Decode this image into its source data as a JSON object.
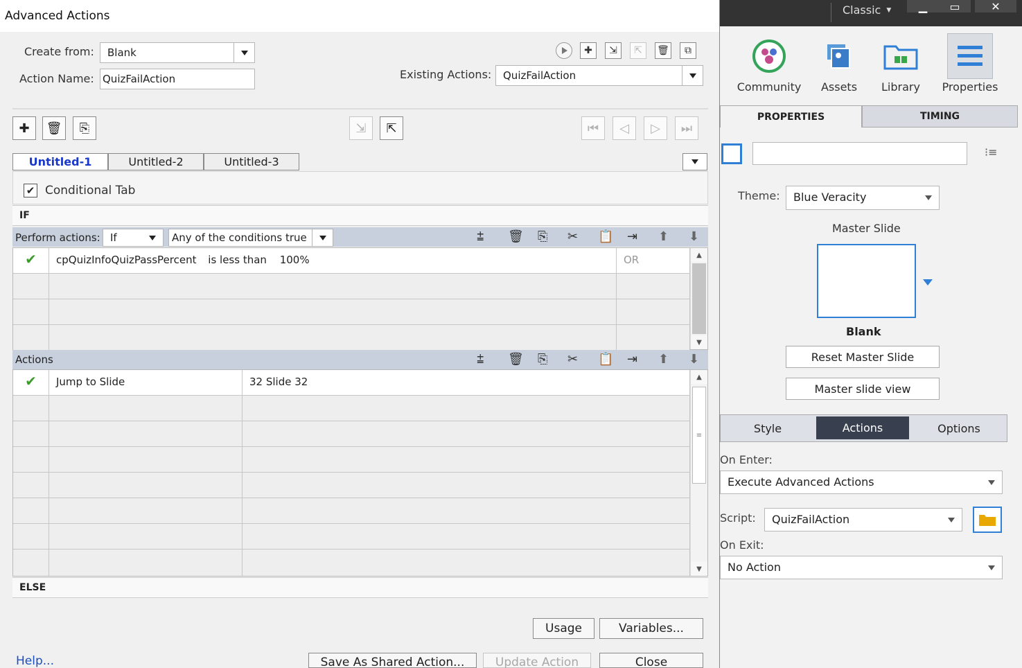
{
  "dialog": {
    "title": "Advanced Actions",
    "create_from_label": "Create from:",
    "create_from_value": "Blank",
    "action_name_label": "Action Name:",
    "action_name_value": "QuizFailAction",
    "existing_actions_label": "Existing Actions:",
    "existing_actions_value": "QuizFailAction",
    "tabs": [
      "Untitled-1",
      "Untitled-2",
      "Untitled-3"
    ],
    "conditional_tab_label": "Conditional Tab",
    "conditional_tab_checked": true,
    "if_label": "IF",
    "perform_actions_label": "Perform actions:",
    "perform_actions_value": "If",
    "conditions_mode_value": "Any of the conditions true",
    "condition": {
      "variable": "cpQuizInfoQuizPassPercent",
      "operator": "is less than",
      "value": "100%",
      "connector": "OR"
    },
    "actions_label": "Actions",
    "action_row": {
      "action": "Jump to Slide",
      "target": "32 Slide 32"
    },
    "else_label": "ELSE",
    "usage_button": "Usage",
    "variables_button": "Variables...",
    "help_link": "Help...",
    "save_shared_button": "Save As Shared Action...",
    "update_button": "Update Action",
    "close_button": "Close"
  },
  "panel": {
    "workspace": "Classic",
    "tools": [
      {
        "label": "Community",
        "icon": "community-icon"
      },
      {
        "label": "Assets",
        "icon": "assets-icon"
      },
      {
        "label": "Library",
        "icon": "library-icon"
      },
      {
        "label": "Properties",
        "icon": "properties-icon"
      }
    ],
    "tab_properties": "PROPERTIES",
    "tab_timing": "TIMING",
    "theme_label": "Theme:",
    "theme_value": "Blue Veracity",
    "master_slide_label": "Master Slide",
    "master_slide_name": "Blank",
    "reset_master_button": "Reset Master Slide",
    "master_view_button": "Master slide view",
    "sub_tabs": [
      "Style",
      "Actions",
      "Options"
    ],
    "on_enter_label": "On Enter:",
    "on_enter_value": "Execute Advanced Actions",
    "script_label": "Script:",
    "script_value": "QuizFailAction",
    "on_exit_label": "On Exit:",
    "on_exit_value": "No Action",
    "colors": {
      "active_subtab": "#384050",
      "accent_blue": "#2f7fd6",
      "folder": "#e8a800"
    }
  }
}
